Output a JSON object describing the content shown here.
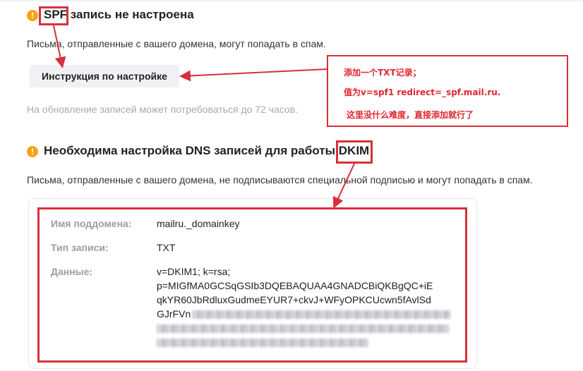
{
  "spf": {
    "heading_highlight": "SPF",
    "heading_rest": " запись не настроена",
    "description": "Письма, отправленные с вашего домена, могут попадать в спам.",
    "button_label": "Инструкция по настройке",
    "update_note": "На обновление записей может потребоваться до 72 часов."
  },
  "dkim": {
    "heading_rest": "Необходима настройка DNS записей для работы ",
    "heading_highlight": "DKIM",
    "description": "Письма, отправленные с вашего домена, не подписываются специальной подписью и могут попадать в спам.",
    "rows": {
      "subdomain_label": "Имя поддомена:",
      "subdomain_value": "mailru._domainkey",
      "type_label": "Тип записи:",
      "type_value": "TXT",
      "data_label": "Данные:",
      "data_lines": [
        "v=DKIM1; k=rsa;",
        "p=MIGfMA0GCSqGSIb3DQEBAQUAA4GNADCBiQKBgQC+iE",
        "qkYR60JbRdluxGudmeEYUR7+ckvJ+WFyOPKCUcwn5fAvlSd",
        "GJrFVn"
      ]
    }
  },
  "annotation": {
    "line1": "添加一个TXT记录；",
    "line2": "值为v=spf1 redirect=_spf.mail.ru.",
    "line3": "这里没什么难度，直接添加就行了"
  },
  "icons": {
    "warning": "warning-circle-icon"
  },
  "colors": {
    "warning": "#f6a316",
    "annotation_red": "#d8303a",
    "button_bg": "#eff1f4"
  }
}
